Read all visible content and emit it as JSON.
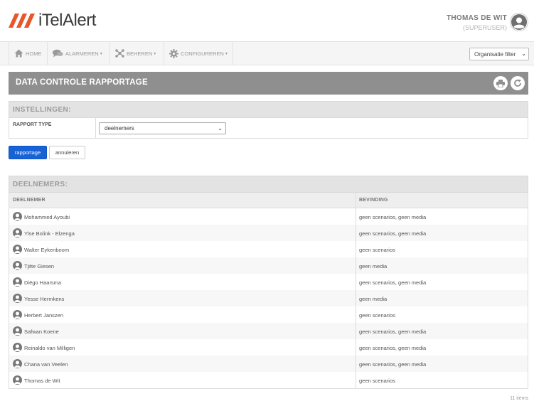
{
  "header": {
    "logo_text": "iTelAlert",
    "user_name": "THOMAS DE WIT",
    "user_role": "(SUPERUSER)",
    "brand_color": "#e8562a"
  },
  "nav": {
    "items": [
      {
        "label": "HOME",
        "icon": "home-icon"
      },
      {
        "label": "ALARMEREN",
        "icon": "chat-icon"
      },
      {
        "label": "BEHEREN",
        "icon": "network-icon"
      },
      {
        "label": "CONFIGUREREN",
        "icon": "gear-icon"
      }
    ],
    "org_filter": "Organisatie filter"
  },
  "page": {
    "title": "DATA CONTROLE RAPPORTAGE"
  },
  "settings": {
    "heading": "INSTELLINGEN:",
    "report_type_label": "RAPPORT TYPE",
    "report_type_value": "deelnemers",
    "submit_label": "rapportage",
    "cancel_label": "annuleren"
  },
  "results": {
    "heading": "DEELNEMERS:",
    "columns": [
      "DEELNEMER",
      "BEVINDING"
    ],
    "rows": [
      {
        "name": "Mohammed Ayoubi",
        "finding": "geen scenarios, geen media"
      },
      {
        "name": "Ylse Bolink - Elzenga",
        "finding": "geen scenarios, geen media"
      },
      {
        "name": "Walter Eykenboom",
        "finding": "geen scenarios"
      },
      {
        "name": "Tjitte Giesen",
        "finding": "geen media"
      },
      {
        "name": "Diëgo Haarsma",
        "finding": "geen scenarios, geen media"
      },
      {
        "name": "Yesse Hermkens",
        "finding": "geen media"
      },
      {
        "name": "Herbert Janszen",
        "finding": "geen scenarios"
      },
      {
        "name": "Safwan Koene",
        "finding": "geen scenarios, geen media"
      },
      {
        "name": "Reinaldo van Milligen",
        "finding": "geen scenarios, geen media"
      },
      {
        "name": "Chana van Veelen",
        "finding": "geen scenarios, geen media"
      },
      {
        "name": "Thomas de Wit",
        "finding": "geen scenarios"
      }
    ],
    "count": "11 items"
  }
}
